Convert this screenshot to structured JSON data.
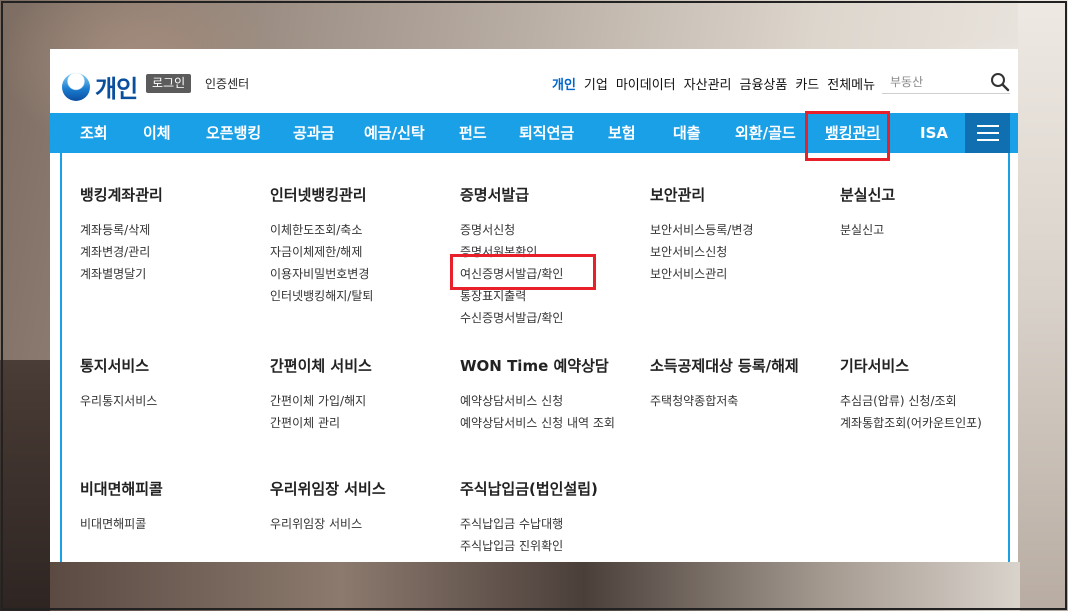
{
  "header": {
    "logo_text": "개인",
    "login_label": "로그인",
    "cert_center_label": "인증센터",
    "top_nav": [
      "개인",
      "기업",
      "마이데이터",
      "자산관리",
      "금융상품",
      "카드",
      "전체메뉴"
    ],
    "search_placeholder": "부동산"
  },
  "main_nav": {
    "items": [
      "조회",
      "이체",
      "오픈뱅킹",
      "공과금",
      "예금/신탁",
      "펀드",
      "퇴직연금",
      "보험",
      "대출",
      "외환/골드",
      "뱅킹관리",
      "ISA"
    ]
  },
  "menu": {
    "groups": [
      {
        "title": "뱅킹계좌관리",
        "links": [
          "계좌등록/삭제",
          "계좌변경/관리",
          "계좌별명달기"
        ]
      },
      {
        "title": "인터넷뱅킹관리",
        "links": [
          "이체한도조회/축소",
          "자금이체제한/해제",
          "이용자비밀번호변경",
          "인터넷뱅킹해지/탈퇴"
        ]
      },
      {
        "title": "증명서발급",
        "links": [
          "증명서신청",
          "증명서원본확인",
          "여신증명서발급/확인",
          "통장표지출력",
          "수신증명서발급/확인"
        ]
      },
      {
        "title": "보안관리",
        "links": [
          "보안서비스등록/변경",
          "보안서비스신청",
          "보안서비스관리"
        ]
      },
      {
        "title": "분실신고",
        "links": [
          "분실신고"
        ]
      },
      {
        "title": "통지서비스",
        "links": [
          "우리통지서비스"
        ]
      },
      {
        "title": "간편이체 서비스",
        "links": [
          "간편이체 가입/해지",
          "간편이체 관리"
        ]
      },
      {
        "title": "WON Time 예약상담",
        "links": [
          "예약상담서비스 신청",
          "예약상담서비스 신청 내역 조회"
        ]
      },
      {
        "title": "소득공제대상 등록/해제",
        "links": [
          "주택청약종합저축"
        ]
      },
      {
        "title": "기타서비스",
        "links": [
          "추심금(압류) 신청/조회",
          "계좌통합조회(어카운트인포)"
        ]
      },
      {
        "title": "비대면해피콜",
        "links": [
          "비대면해피콜"
        ]
      },
      {
        "title": "우리위임장 서비스",
        "links": [
          "우리위임장 서비스"
        ]
      },
      {
        "title": "주식납입금(법인설립)",
        "links": [
          "주식납입금 수납대행",
          "주식납입금 진위확인"
        ]
      }
    ]
  },
  "colors": {
    "nav_blue": "#1aa0e6",
    "hamburger_blue": "#0f6fb0",
    "highlight_red": "#e8202a",
    "active_link": "#0066cc"
  },
  "icons": [
    "logo-mark-icon",
    "search-icon",
    "hamburger-menu-icon"
  ]
}
